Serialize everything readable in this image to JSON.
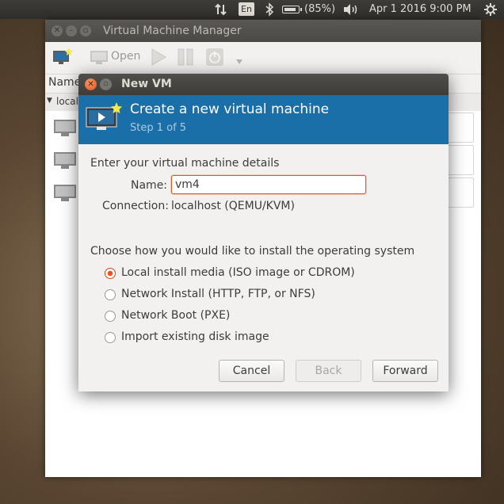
{
  "top_panel": {
    "keyboard_layout": "En",
    "battery_text": "(85%)",
    "battery_level": 0.85,
    "clock": "Apr  1 2016  9:00 PM"
  },
  "main_window": {
    "title": "Virtual Machine Manager",
    "toolbar": {
      "open_label": "Open"
    },
    "list": {
      "column_name": "Name",
      "group_label": "local"
    }
  },
  "dialog": {
    "title": "New VM",
    "header_title": "Create a new virtual machine",
    "header_step": "Step 1 of 5",
    "details_title": "Enter your virtual machine details",
    "name_label": "Name:",
    "name_value": "vm4",
    "connection_label": "Connection:",
    "connection_value": "localhost (QEMU/KVM)",
    "install_title": "Choose how you would like to install the operating system",
    "install_options": [
      {
        "label": "Local install media (ISO image or CDROM)",
        "selected": true
      },
      {
        "label": "Network Install (HTTP, FTP, or NFS)",
        "selected": false
      },
      {
        "label": "Network Boot (PXE)",
        "selected": false
      },
      {
        "label": "Import existing disk image",
        "selected": false
      }
    ],
    "buttons": {
      "cancel": "Cancel",
      "back": "Back",
      "forward": "Forward"
    }
  },
  "colors": {
    "accent": "#e95420",
    "header_blue": "#1a6fa9"
  }
}
